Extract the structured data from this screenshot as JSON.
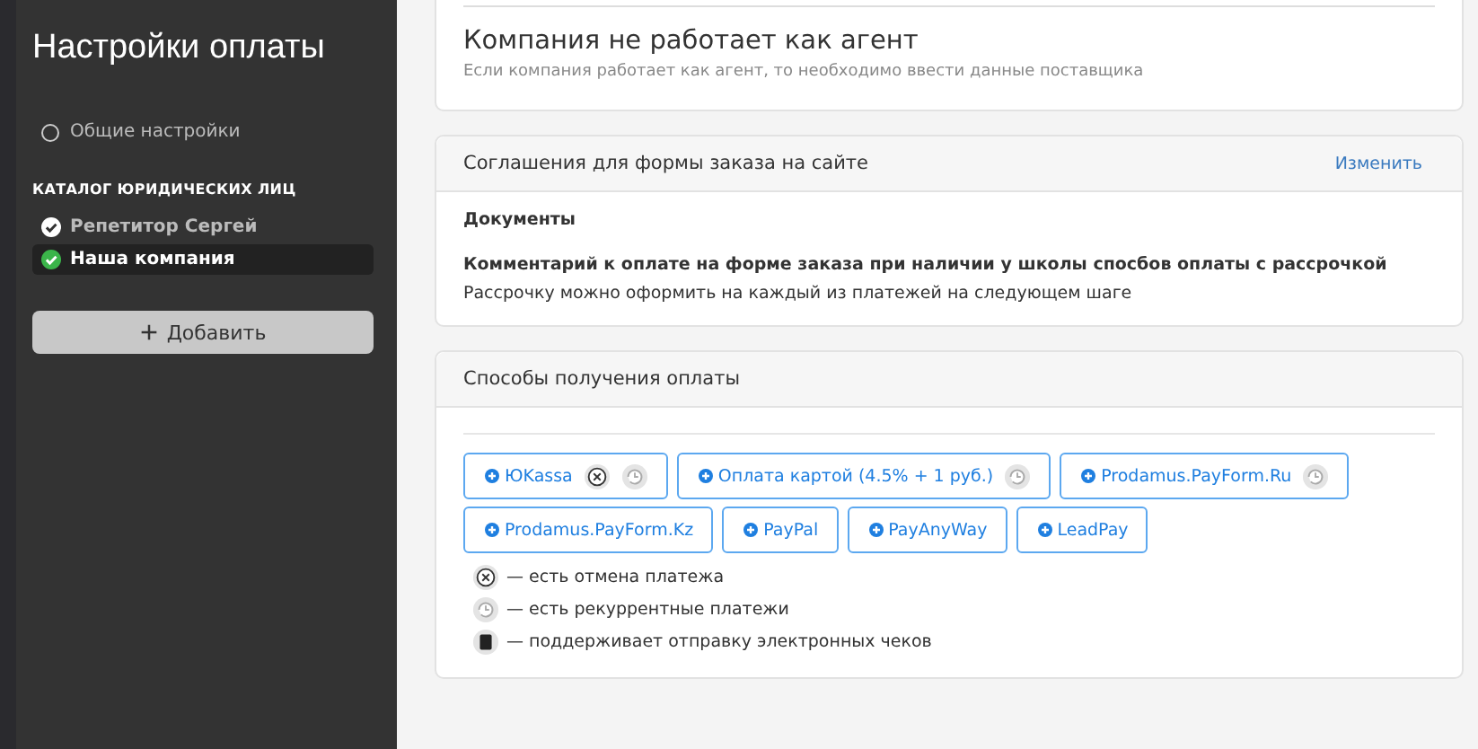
{
  "sidebar": {
    "title": "Настройки оплаты",
    "general": {
      "label": "Общие настройки",
      "selected": false
    },
    "catalog_title": "КАТАЛОГ ЮРИДИЧЕСКИХ ЛИЦ",
    "entities": [
      {
        "label": "Репетитор Сергей",
        "selected": false
      },
      {
        "label": "Наша компания",
        "selected": true
      }
    ],
    "add_button": "Добавить"
  },
  "agent_card": {
    "title": "Компания не работает как агент",
    "hint": "Если компания работает как агент, то необходимо ввести данные поставщика"
  },
  "agreements_card": {
    "title": "Соглашения для формы заказа на сайте",
    "edit_link": "Изменить",
    "documents": "Документы",
    "comment_title": "Комментарий к оплате на форме заказа при наличии у школы спосбов оплаты с рассрочкой",
    "comment_text": "Рассрочку можно оформить на каждый из платежей на следующем шаге"
  },
  "payments_card": {
    "title": "Способы получения оплаты",
    "methods": [
      {
        "label": "ЮKassa",
        "cancel": true,
        "recurring": true
      },
      {
        "label": "Оплата картой (4.5% + 1 руб.)",
        "cancel": false,
        "recurring": true
      },
      {
        "label": "Prodamus.PayForm.Ru",
        "cancel": false,
        "recurring": true
      },
      {
        "label": "Prodamus.PayForm.Kz",
        "cancel": false,
        "recurring": false
      },
      {
        "label": "PayPal",
        "cancel": false,
        "recurring": false
      },
      {
        "label": "PayAnyWay",
        "cancel": false,
        "recurring": false
      },
      {
        "label": "LeadPay",
        "cancel": false,
        "recurring": false
      }
    ],
    "legend": [
      {
        "kind": "cancel",
        "text": "— есть отмена платежа"
      },
      {
        "kind": "recurring",
        "text": "— есть рекуррентные платежи"
      },
      {
        "kind": "receipt",
        "text": "— поддерживает отправку электронных чеков"
      }
    ]
  }
}
